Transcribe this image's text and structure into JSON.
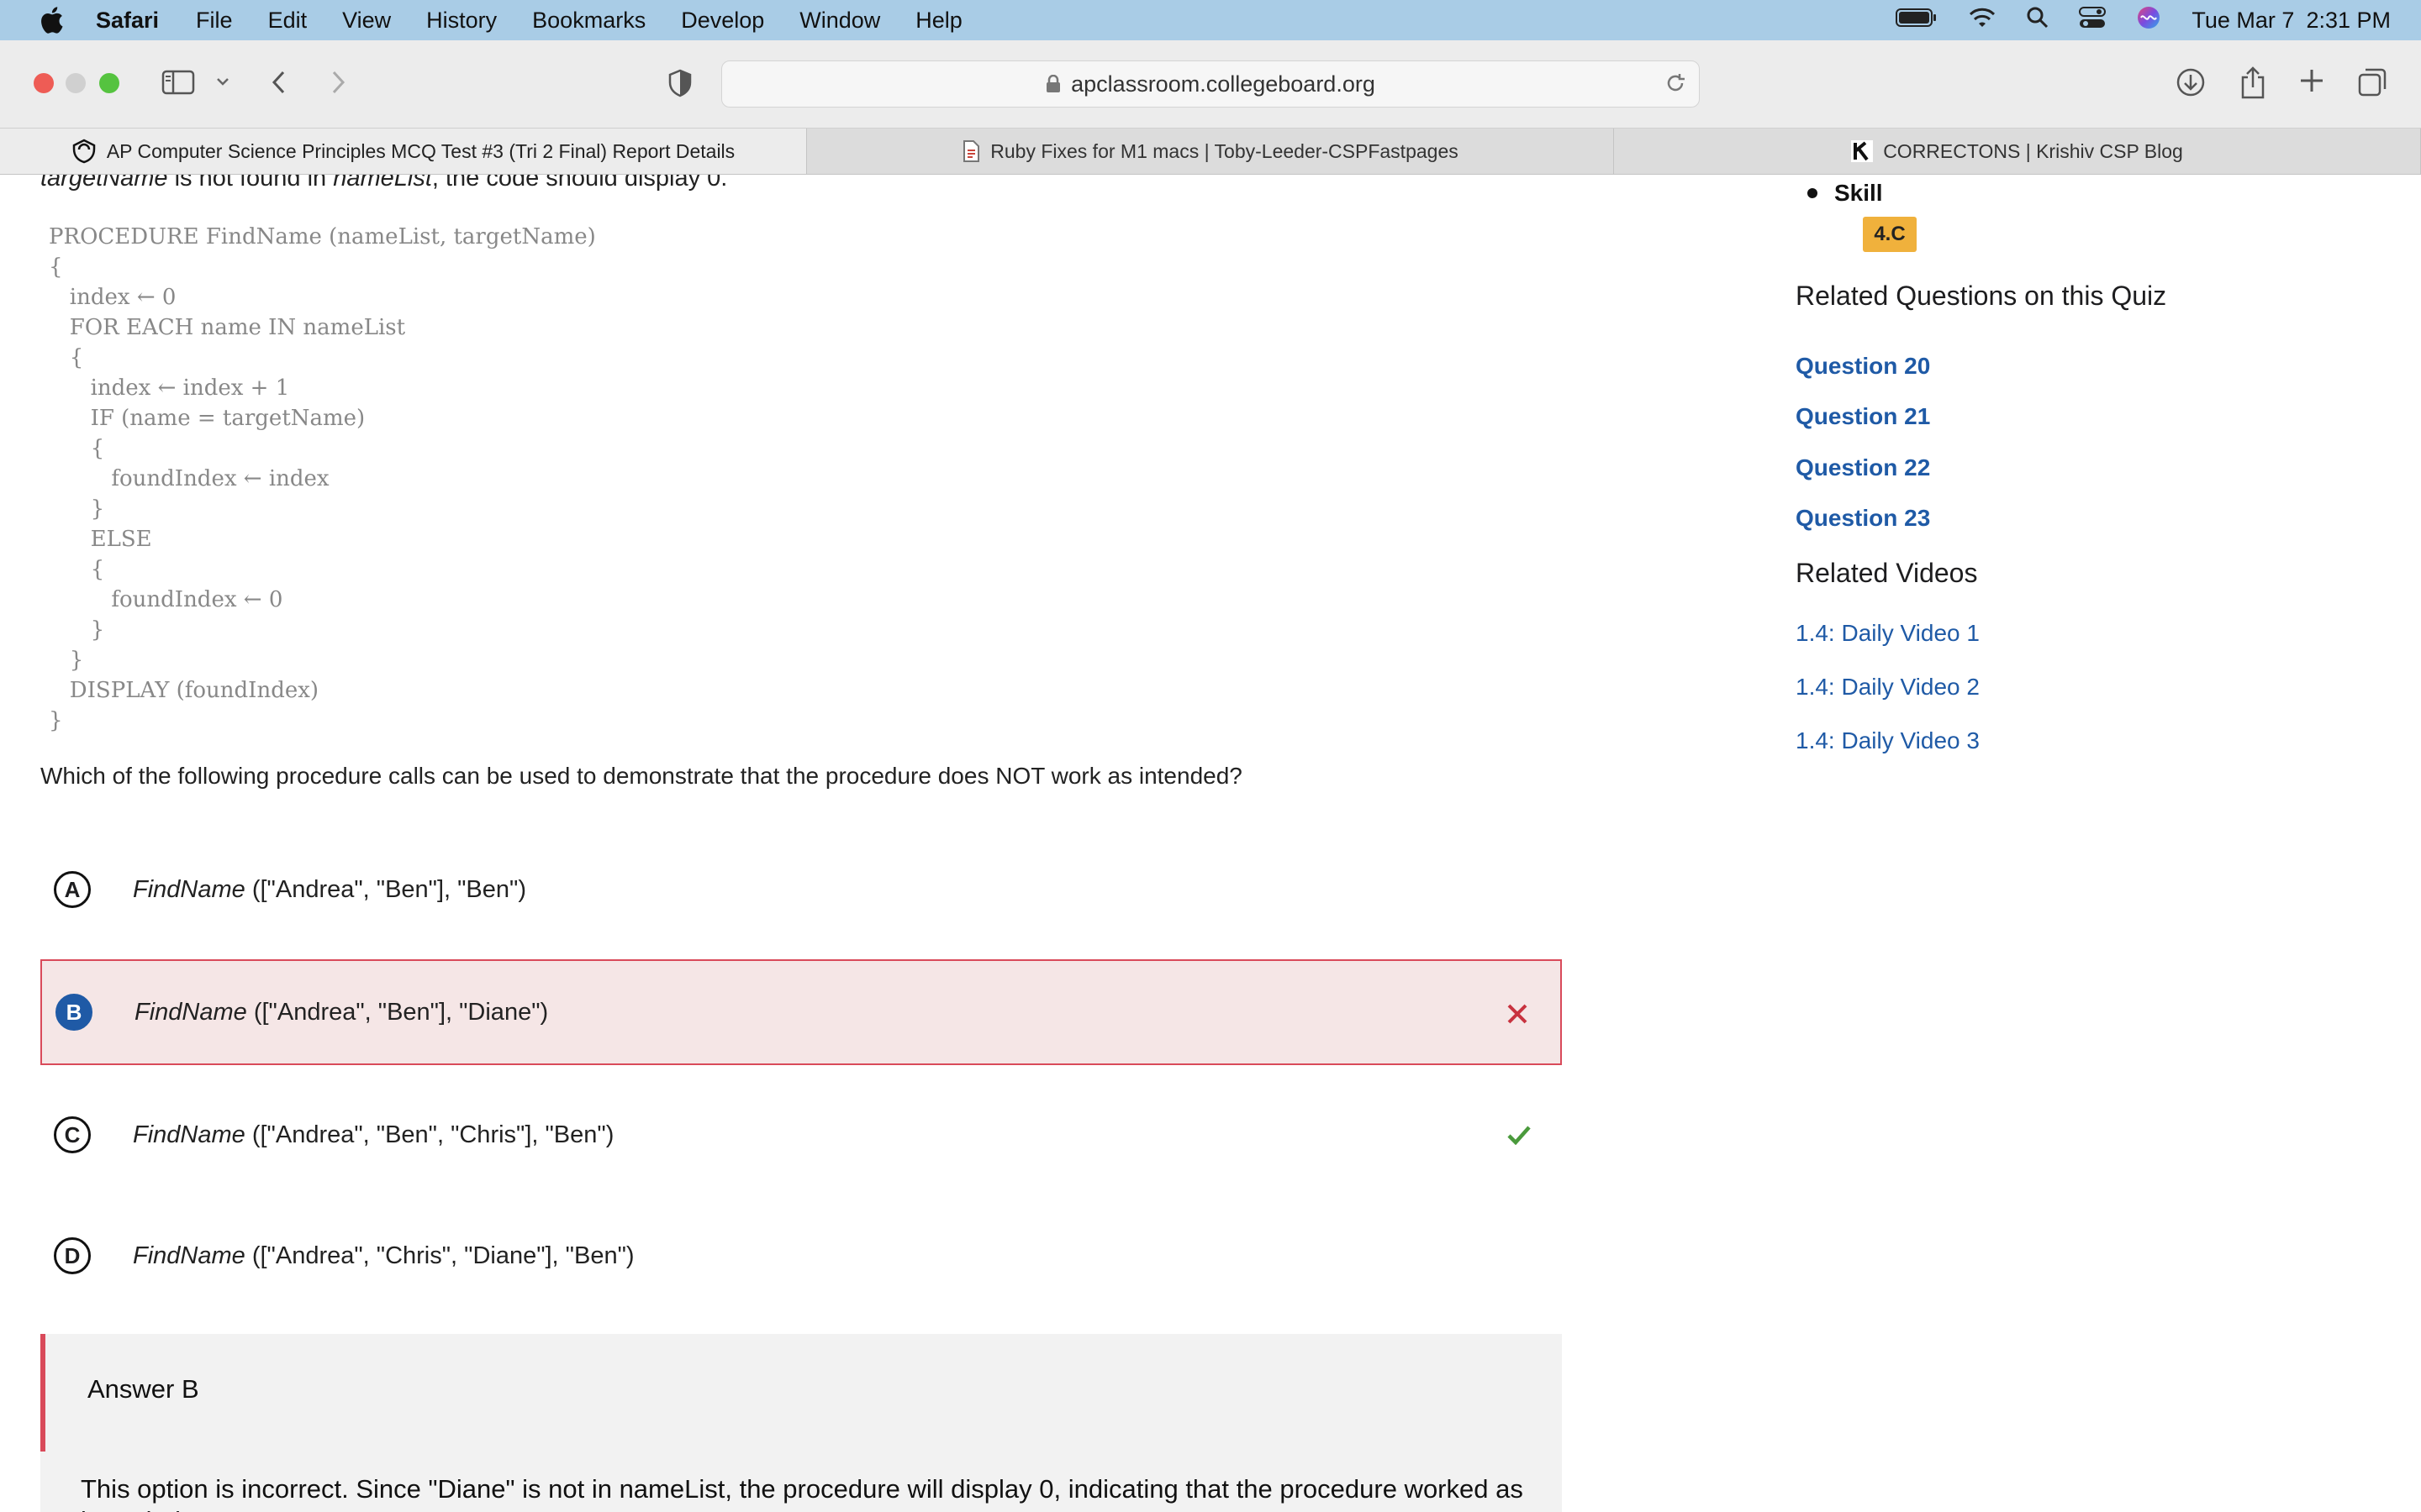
{
  "menubar": {
    "app": "Safari",
    "items": [
      "File",
      "Edit",
      "View",
      "History",
      "Bookmarks",
      "Develop",
      "Window",
      "Help"
    ],
    "date": "Tue Mar 7",
    "time": "2:31 PM"
  },
  "toolbar": {
    "url": "apclassroom.collegeboard.org"
  },
  "tabs": [
    {
      "label": "AP Computer Science Principles MCQ Test #3 (Tri 2 Final) Report Details",
      "icon": "collegeboard-icon",
      "active": true
    },
    {
      "label": "Ruby Fixes for M1 macs | Toby-Leeder-CSPFastpages",
      "icon": "page-icon",
      "active": false
    },
    {
      "label": "CORRECTONS | Krishiv CSP Blog",
      "icon": "k-logo-icon",
      "active": false
    }
  ],
  "question": {
    "intro_part1": "targetName",
    "intro_part2": " is not found in ",
    "intro_part3": "nameList",
    "intro_part4": ", the code should display 0.",
    "code": "PROCEDURE FindName (nameList, targetName)\n{\n   index ← 0\n   FOR EACH name IN nameList\n   {\n      index ← index + 1\n      IF (name = targetName)\n      {\n         foundIndex ← index\n      }\n      ELSE\n      {\n         foundIndex ← 0\n      }\n   }\n   DISPLAY (foundIndex)\n}",
    "prompt": "Which of the following procedure calls can be used to demonstrate that the procedure does NOT work as intended?",
    "choices": [
      {
        "letter": "A",
        "func": "FindName",
        "args": " ([\"Andrea\", \"Ben\"], \"Ben\")",
        "status": "none"
      },
      {
        "letter": "B",
        "func": "FindName",
        "args": " ([\"Andrea\", \"Ben\"], \"Diane\")",
        "status": "incorrect-selected"
      },
      {
        "letter": "C",
        "func": "FindName",
        "args": " ([\"Andrea\", \"Ben\", \"Chris\"], \"Ben\")",
        "status": "correct"
      },
      {
        "letter": "D",
        "func": "FindName",
        "args": " ([\"Andrea\", \"Chris\", \"Diane\"], \"Ben\")",
        "status": "none"
      }
    ],
    "answer_heading": "Answer B",
    "answer_text": "This option is incorrect. Since \"Diane\" is not in nameList, the procedure will display 0, indicating that the procedure worked as intended."
  },
  "sidebar": {
    "skill_label": "Skill",
    "skill_badge": "4.C",
    "related_questions_heading": "Related Questions on this Quiz",
    "related_questions": [
      "Question 20",
      "Question 21",
      "Question 22",
      "Question 23"
    ],
    "related_videos_heading": "Related Videos",
    "related_videos": [
      "1.4: Daily Video 1",
      "1.4: Daily Video 2",
      "1.4: Daily Video 3"
    ]
  },
  "colors": {
    "menubar": "#a9cce6",
    "incorrect": "#d94a5a",
    "correct": "#4a9a3c",
    "link": "#1f5aa6",
    "badge": "#f0b13c"
  }
}
